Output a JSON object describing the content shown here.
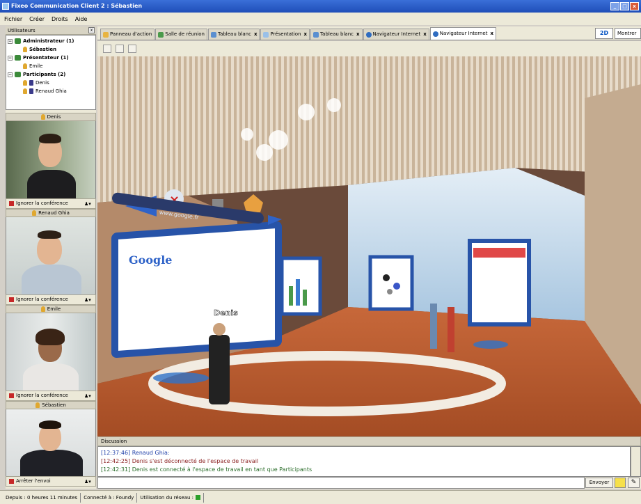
{
  "window": {
    "title": "Fixeo Communication Client 2 : Sébastien"
  },
  "menu": [
    "Fichier",
    "Créer",
    "Droits",
    "Aide"
  ],
  "users_panel": {
    "title": "Utilisateurs",
    "groups": [
      {
        "label": "Administrateur (1)",
        "members": [
          "Sébastien"
        ]
      },
      {
        "label": "Présentateur (1)",
        "members": [
          "Emile"
        ]
      },
      {
        "label": "Participants (2)",
        "members": [
          "Denis",
          "Renaud Ghia"
        ]
      }
    ]
  },
  "webcams": [
    {
      "name": "Denis",
      "action": "Ignorer la conférence"
    },
    {
      "name": "Renaud Ghia",
      "action": "Ignorer la conférence"
    },
    {
      "name": "Emile",
      "action": "Ignorer la conférence"
    },
    {
      "name": "Sébastien",
      "action": "Arrêter l'envoi"
    }
  ],
  "tabs": [
    {
      "label": "Panneau d'action",
      "closable": false,
      "active": false
    },
    {
      "label": "Salle de réunion",
      "closable": false,
      "active": false
    },
    {
      "label": "Tableau blanc",
      "closable": true,
      "active": false
    },
    {
      "label": "Présentation",
      "closable": true,
      "active": false
    },
    {
      "label": "Tableau blanc",
      "closable": true,
      "active": false
    },
    {
      "label": "Navigateur Internet",
      "closable": true,
      "active": false
    },
    {
      "label": "Navigateur Internet",
      "closable": true,
      "active": true
    }
  ],
  "view_buttons": {
    "mode_2d": "2D",
    "monitor": "Montrer"
  },
  "scene": {
    "avatar_label": "Denis",
    "url_bar": "www.google.fr",
    "screen_brand": "Google"
  },
  "discussion": {
    "title": "Discussion",
    "messages": [
      {
        "time": "[12:37:46]",
        "text": "Renaud Ghia:"
      },
      {
        "time": "[12:42:25]",
        "text": "Denis s'est déconnecté de l'espace de travail"
      },
      {
        "time": "[12:42:31]",
        "text": "Denis est connecté à l'espace de travail en tant que Participants"
      }
    ],
    "send_label": "Envoyer"
  },
  "status": {
    "duration": "Depuis : 0 heures 11 minutes",
    "connected": "Connecté à : Foundy",
    "network": "Utilisation du réseau :"
  },
  "colors": {
    "title_bar": "#1f4eb8",
    "panel": "#ece9d8",
    "status_ok": "#2aa02a"
  }
}
